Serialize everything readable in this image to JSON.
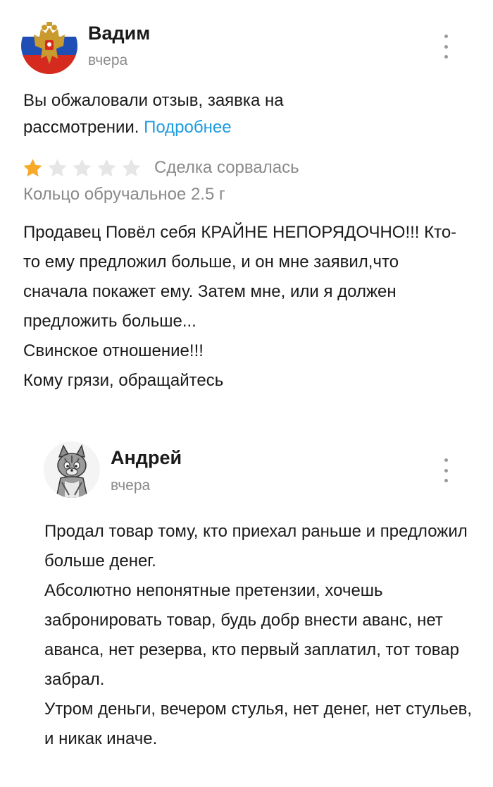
{
  "review": {
    "author": {
      "name": "Вадим",
      "date": "вчера"
    },
    "appeal": {
      "text": "Вы обжаловали отзыв, заявка на рассмотрении.",
      "link_label": "Подробнее"
    },
    "rating": {
      "value": 1,
      "max": 5,
      "filled_color": "#f7a928",
      "empty_color": "#e6e6e6"
    },
    "deal_status": "Сделка сорвалась",
    "product": "Кольцо обручальное 2.5 г",
    "body": [
      "Продавец Повёл себя КРАЙНЕ НЕПОРЯДОЧНО!!! Кто-то ему предложил больше, и он мне заявил,что сначала покажет ему. Затем мне, или я должен предложить больше...",
      "Свинское отношение!!!",
      "Кому грязи, обращайтесь"
    ]
  },
  "reply": {
    "author": {
      "name": "Андрей",
      "date": "вчера"
    },
    "body": [
      "Продал товар тому, кто приехал раньше и предложил больше денег.",
      "Абсолютно непонятные претензии, хочешь забронировать товар, будь добр внести аванс, нет аванса, нет резерва, кто первый заплатил, тот товар забрал.",
      "Утром деньги, вечером стулья, нет денег, нет стульев, и никак иначе."
    ]
  },
  "icons": {
    "more": "more-vertical-icon",
    "star": "star-icon"
  }
}
